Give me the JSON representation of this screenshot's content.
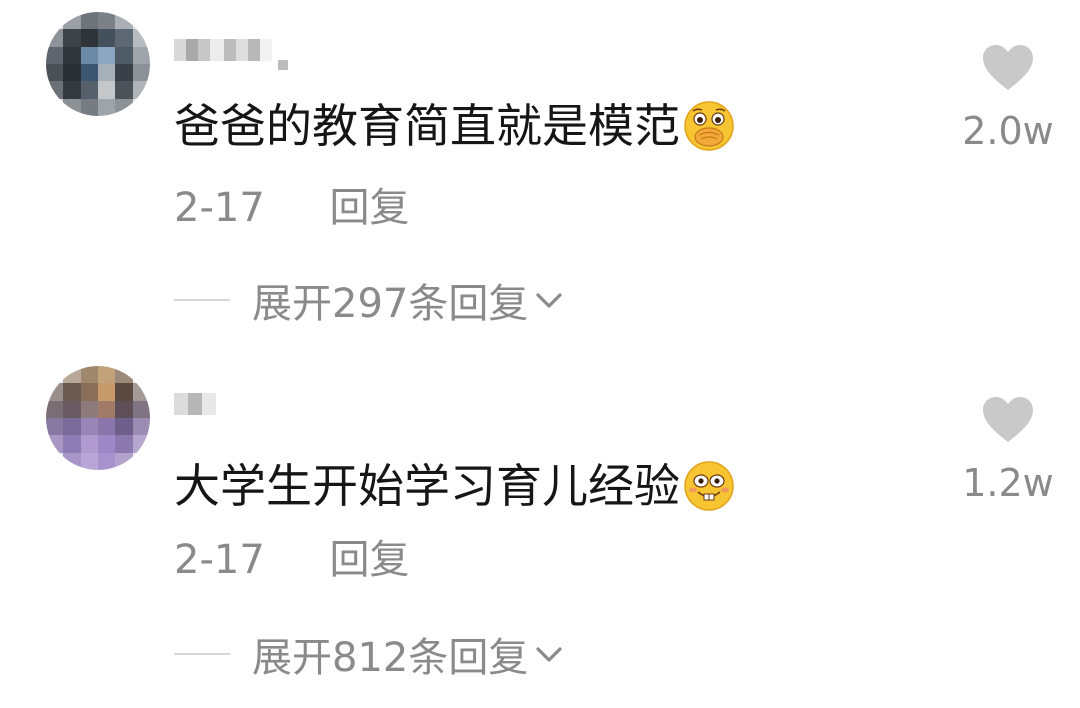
{
  "comments": [
    {
      "text": "爸爸的教育简直就是模范",
      "emoji": "covering-mouth-emoji",
      "date": "2-17",
      "reply_label": "回复",
      "expand_label": "展开297条回复",
      "likes": "2.0w"
    },
    {
      "text": "大学生开始学习育儿经验",
      "emoji": "buck-teeth-grin-emoji",
      "date": "2-17",
      "reply_label": "回复",
      "expand_label": "展开812条回复",
      "likes": "1.2w"
    }
  ],
  "icons": {
    "like": "heart-icon",
    "expand": "chevron-down-icon"
  },
  "colors": {
    "text": "#161616",
    "secondary": "#8a8a8a",
    "heart": "#c9c9c9",
    "emoji_yellow": "#f7c531"
  }
}
